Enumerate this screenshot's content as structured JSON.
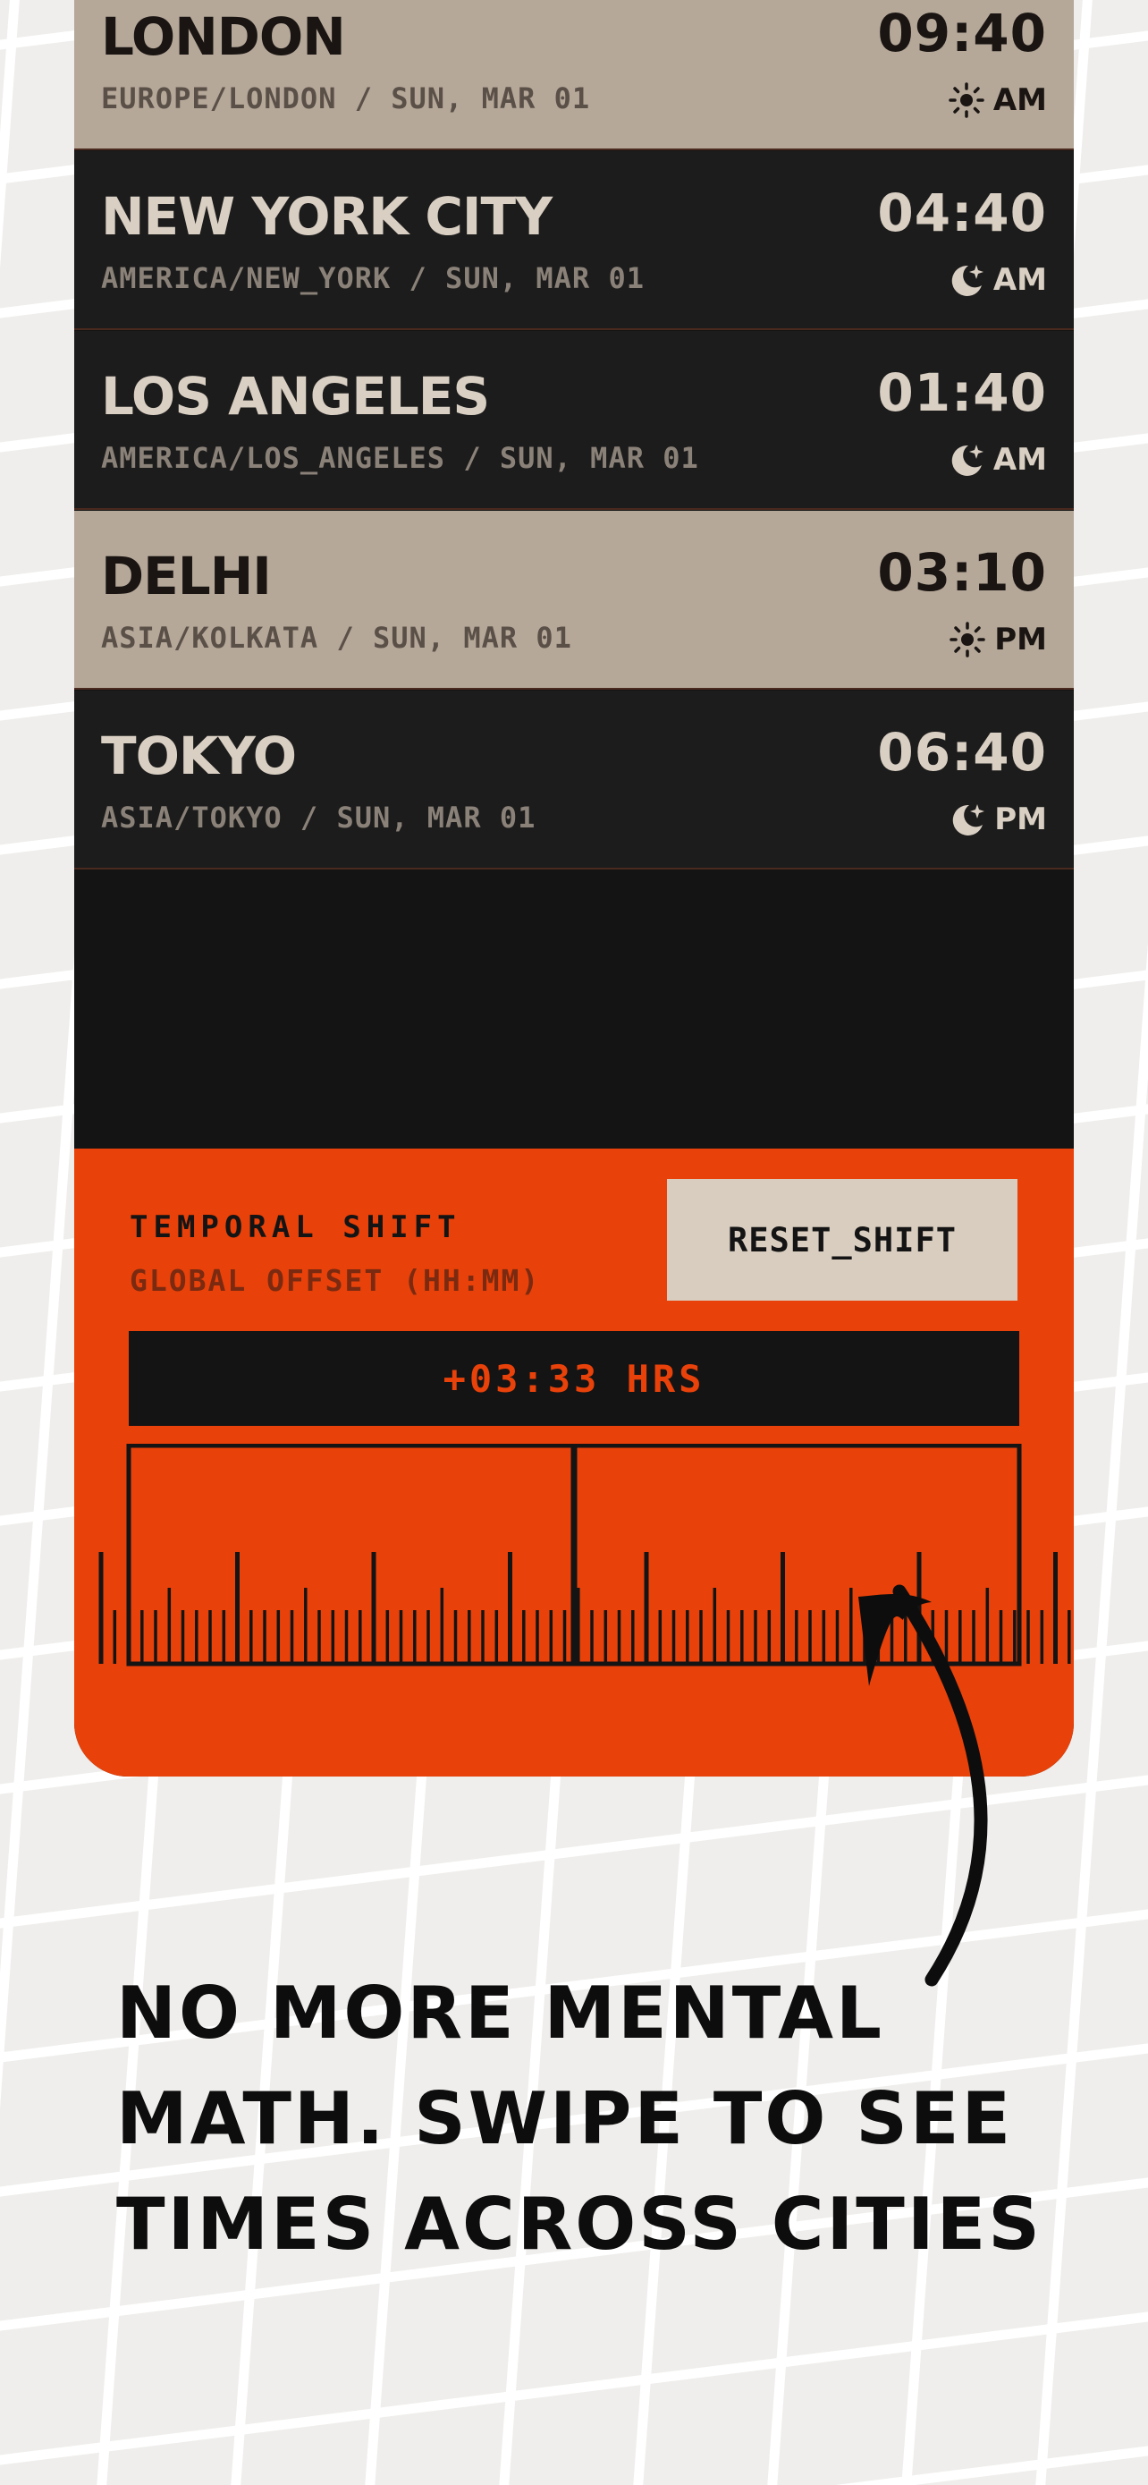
{
  "cities": [
    {
      "name": "LONDON",
      "tz": "EUROPE/LONDON / SUN, MAR 01",
      "time": "09:40",
      "period": "AM",
      "theme": "day",
      "icon": "sun-icon"
    },
    {
      "name": "NEW YORK CITY",
      "tz": "AMERICA/NEW_YORK / SUN, MAR 01",
      "time": "04:40",
      "period": "AM",
      "theme": "night",
      "icon": "moon-icon"
    },
    {
      "name": "LOS ANGELES",
      "tz": "AMERICA/LOS_ANGELES / SUN, MAR 01",
      "time": "01:40",
      "period": "AM",
      "theme": "night",
      "icon": "moon-icon"
    },
    {
      "name": "DELHI",
      "tz": "ASIA/KOLKATA / SUN, MAR 01",
      "time": "03:10",
      "period": "PM",
      "theme": "day",
      "icon": "sun-icon"
    },
    {
      "name": "TOKYO",
      "tz": "ASIA/TOKYO / SUN, MAR 01",
      "time": "06:40",
      "period": "PM",
      "theme": "night",
      "icon": "moon-icon"
    }
  ],
  "shift": {
    "title": "TEMPORAL SHIFT",
    "subtitle": "GLOBAL OFFSET (HH:MM)",
    "reset_label": "RESET_SHIFT",
    "offset": "+03:33 HRS"
  },
  "headline": "NO MORE MENTAL MATH. SWIPE TO SEE TIMES ACROSS CITIES",
  "colors": {
    "accent": "#e8410a",
    "day_row": "#b5a899",
    "night_row": "#1c1c1c",
    "dark": "#141414",
    "button": "#d8cdbf"
  }
}
